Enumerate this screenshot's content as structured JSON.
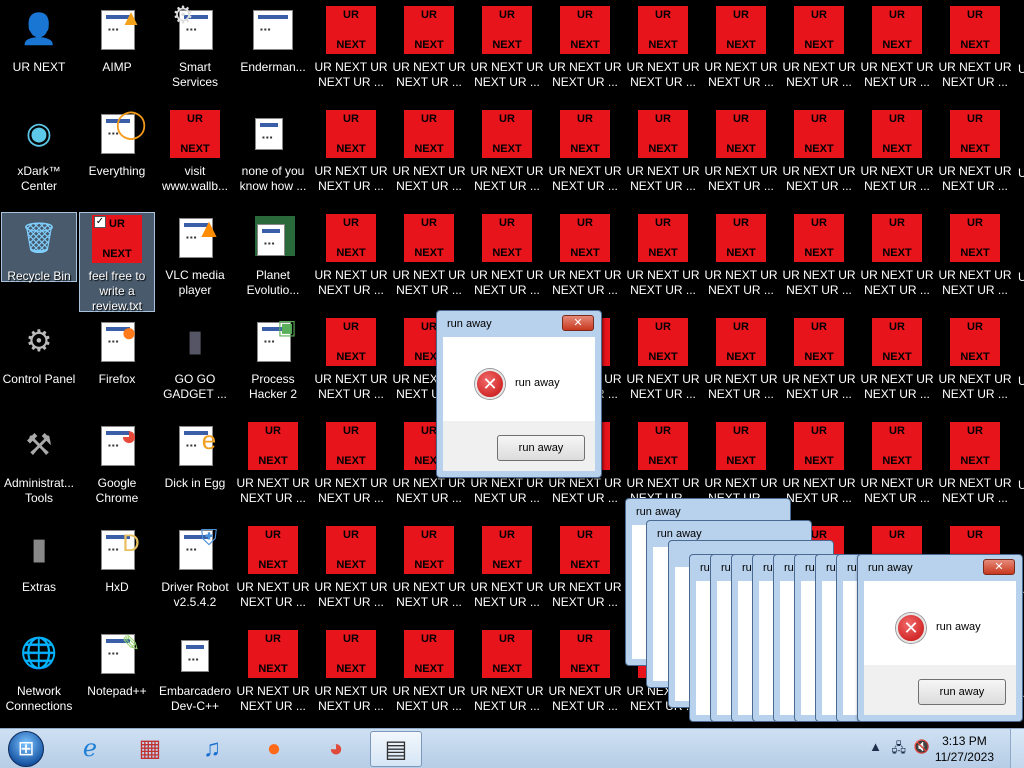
{
  "desktop": {
    "col0": [
      {
        "label": "UR NEXT",
        "icon": "chibi-character-icon"
      },
      {
        "label": "xDark™ Center",
        "icon": "xdark-orb-icon"
      },
      {
        "label": "Recycle Bin",
        "icon": "recycle-bin-icon"
      },
      {
        "label": "Control Panel",
        "icon": "control-panel-icon"
      },
      {
        "label": "Administrat... Tools",
        "icon": "admin-tools-icon"
      },
      {
        "label": "Extras",
        "icon": "folder-icon"
      },
      {
        "label": "Network Connections",
        "icon": "network-icon"
      }
    ],
    "col1": [
      {
        "label": "AIMP",
        "icon": "aimp-icon"
      },
      {
        "label": "Everything",
        "icon": "everything-icon"
      },
      {
        "label": "feel free to write a review.txt",
        "icon": "text-file-icon"
      },
      {
        "label": "Firefox",
        "icon": "firefox-icon"
      },
      {
        "label": "Google Chrome",
        "icon": "chrome-icon"
      },
      {
        "label": "HxD",
        "icon": "hxd-icon"
      },
      {
        "label": "Notepad++",
        "icon": "notepadpp-icon"
      }
    ],
    "col2": [
      {
        "label": "Smart Services",
        "icon": "gear-icon"
      },
      {
        "label": "visit www.wallb...",
        "icon": "red-tile-icon"
      },
      {
        "label": "VLC media player",
        "icon": "vlc-icon"
      },
      {
        "label": "GO GO GADGET ...",
        "icon": "gadget-icon"
      },
      {
        "label": "Dick in Egg",
        "icon": "egg-app-icon"
      },
      {
        "label": "Driver Robot v2.5.4.2",
        "icon": "driver-robot-icon"
      },
      {
        "label": "Embarcadero Dev-C++",
        "icon": "devcpp-icon"
      }
    ],
    "col3": [
      {
        "label": "Enderman...",
        "icon": "window-app-icon"
      },
      {
        "label": "none of you know how ...",
        "icon": "app-icon"
      },
      {
        "label": "Planet Evolutio...",
        "icon": "planet-icon"
      },
      {
        "label": "Process Hacker 2",
        "icon": "process-hacker-icon"
      },
      {
        "label": "UR NEXT UR NEXT UR ..."
      },
      {
        "label": "UR NEXT UR NEXT UR ..."
      },
      {
        "label": "UR NEXT UR NEXT UR ..."
      }
    ],
    "tile_label": "UR NEXT UR NEXT UR ...",
    "tile_top": "UR",
    "tile_bottom": "NEXT"
  },
  "dialogs": {
    "title": "run away",
    "message": "run away",
    "button": "run away",
    "close": "✕",
    "ghost_title_1": "run away",
    "ghost_title_2": "run away",
    "ghost_title_3": "ru"
  },
  "taskbar": {
    "time": "3:13 PM",
    "date": "11/27/2023",
    "pinned": [
      "internet-explorer-icon",
      "store-bag-icon",
      "music-note-icon",
      "firefox-icon",
      "chrome-icon",
      "notepad-icon"
    ]
  },
  "colors": {
    "tile_red": "#e8141b",
    "taskbar": "#c4d8ee"
  }
}
